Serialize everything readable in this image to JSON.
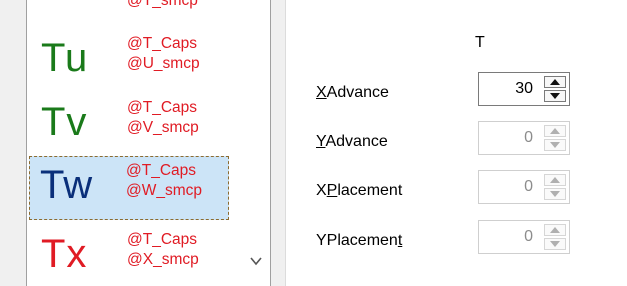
{
  "glyph_list": {
    "top_partial": "@T_smcp",
    "items": [
      {
        "glyph": "Tu",
        "color": "#1a7a1a",
        "line1": "@T_Caps",
        "line2": "@U_smcp",
        "selected": false
      },
      {
        "glyph": "Tv",
        "color": "#1a7a1a",
        "line1": "@T_Caps",
        "line2": "@V_smcp",
        "selected": false
      },
      {
        "glyph": "Tw",
        "color": "#0a2f7a",
        "line1": "@T_Caps",
        "line2": "@W_smcp",
        "selected": true
      },
      {
        "glyph": "Tx",
        "color": "#e01b24",
        "line1": "@T_Caps",
        "line2": "@X_smcp",
        "selected": false
      }
    ]
  },
  "properties": {
    "column_header": "T",
    "rows": [
      {
        "label_pre": "",
        "label_u": "X",
        "label_post": "Advance",
        "value": "30",
        "enabled": true
      },
      {
        "label_pre": "",
        "label_u": "Y",
        "label_post": "Advance",
        "value": "0",
        "enabled": false
      },
      {
        "label_pre": "X",
        "label_u": "P",
        "label_post": "lacement",
        "value": "0",
        "enabled": false
      },
      {
        "label_pre": "YPlacemen",
        "label_u": "t",
        "label_post": "",
        "value": "0",
        "enabled": false
      }
    ]
  },
  "icons": {
    "scroll": "chevron-down-icon",
    "spin_up": "spin-up-icon",
    "spin_down": "spin-down-icon"
  }
}
